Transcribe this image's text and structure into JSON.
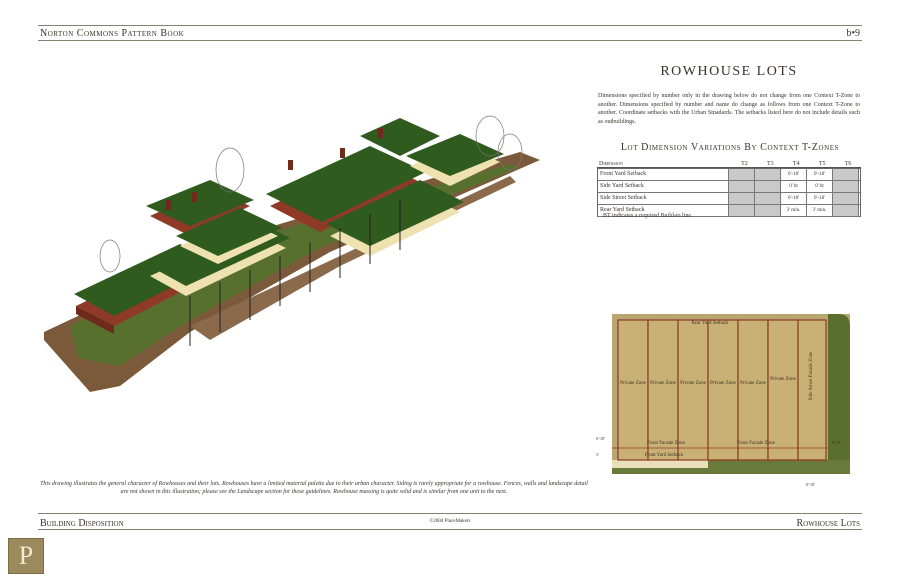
{
  "header": {
    "left": "Norton Commons Pattern Book",
    "right": "b•9"
  },
  "footer": {
    "left": "Building Disposition",
    "center": "©2004 PlaceMakers",
    "right": "Rowhouse Lots"
  },
  "logo": {
    "letter": "P",
    "color": "#9b8a5c"
  },
  "title": "ROWHOUSE LOTS",
  "intro": "Dimensions specified by number only in the drawing below do not change from one Context T-Zone to another. Dimensions specified by number and name do change as follows from one Context T-Zone to another. Coordinate setbacks with the Urban Stnadards. The setbacks listed here do not include details such as outbuildings.",
  "table": {
    "title": "Lot Dimension Variations By Context T-Zones",
    "headers": [
      "Dimension",
      "T2",
      "T3",
      "T4",
      "T5",
      "T6"
    ],
    "rows": [
      {
        "label": "Front Yard Setback",
        "t2": "",
        "t3": "",
        "t4": "6'-18'",
        "t5": "0'-18'",
        "t6": ""
      },
      {
        "label": "Side Yard Setback",
        "t2": "",
        "t3": "",
        "t4": "0' bt",
        "t5": "0' bt",
        "t6": ""
      },
      {
        "label": "Side Street Setback",
        "t2": "",
        "t3": "",
        "t4": "6'-18'",
        "t5": "0'-18'",
        "t6": ""
      },
      {
        "label": "Rear Yard Setback",
        "t2": "",
        "t3": "",
        "t4": "3' min.",
        "t5": "3' min.",
        "t6": ""
      }
    ],
    "note": "BT indicates a required Build-to line."
  },
  "caption": "This drawing illustrates the general character of Rowhouses and their lots. Rowhouses have a limited material palette due to their urban character. Siding is rarely appropriate for a rowhouse. Fences, walls and landscape detail are not shown in this illustration; please see the Landscape section for these guidelines. Rowhouse massing is quite solid and is similar from one unit to the next.",
  "plan": {
    "rear_label": "Rear Yard Setback",
    "private_zone": "Private Zone",
    "side_street_label": "Side Street Facade Zone",
    "front_facade_label": "Front Facade Zone",
    "front_yard_label": "Front Yard Setback",
    "dims": [
      "0'-18'",
      "3'",
      "6'-18'",
      "0'-18'"
    ]
  },
  "colors": {
    "roof": "#2f5b1e",
    "brick": "#8e3a26",
    "cream": "#ede2b0",
    "lot": "#c9b074",
    "street": "#8a6a4a",
    "grass": "#5a6e2e"
  }
}
